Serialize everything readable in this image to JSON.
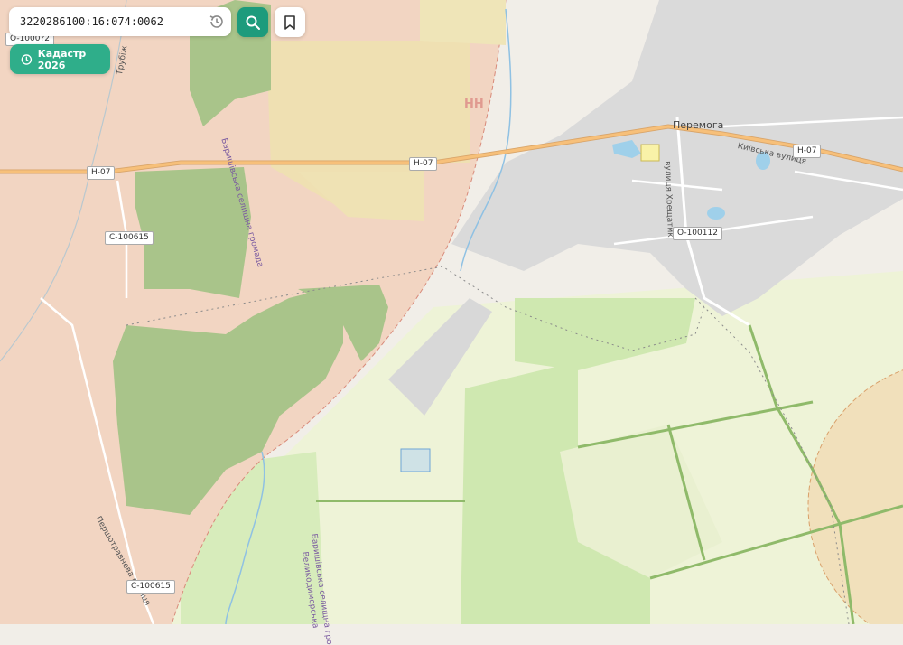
{
  "search": {
    "value": "3220286100:16:074:0062"
  },
  "cadastre_button": {
    "label": "Кадастр 2026"
  },
  "map": {
    "places": {
      "peremoha": "Перемога"
    },
    "streets": {
      "kyivska": "Київська вулиця",
      "khreshchatyk": "вулиця Хрещатик",
      "pershotravneva": "Першотравнева вулиця",
      "trubizh": "Трубіж"
    },
    "admin": {
      "baryshivska_1": "Баришівська селищна громада",
      "baryshivska_2": "Баришівська селищна гро",
      "velykodymerska": "Великодимерська"
    },
    "roads": {
      "h07_1": "H-07",
      "h07_2": "H-07",
      "h07_3": "H-07",
      "c100615_1": "C-100615",
      "c100615_2": "C-100615",
      "o100112": "O-100112",
      "o_partial": "O-1000?2"
    },
    "marker_text": "НН"
  },
  "colors": {
    "accent": "#1d9b7c",
    "accent_light": "#2fae8a",
    "forest": "#a9c48a",
    "farmland": "#eee6bd",
    "grass": "#d4ecb7",
    "residential": "#d9d9d9",
    "cadastre_pink": "#f2c9b6",
    "road": "#f7c07a"
  },
  "icons": {
    "history": "history-icon",
    "search": "search-icon",
    "bookmark": "bookmark-icon",
    "clock": "clock-icon"
  }
}
